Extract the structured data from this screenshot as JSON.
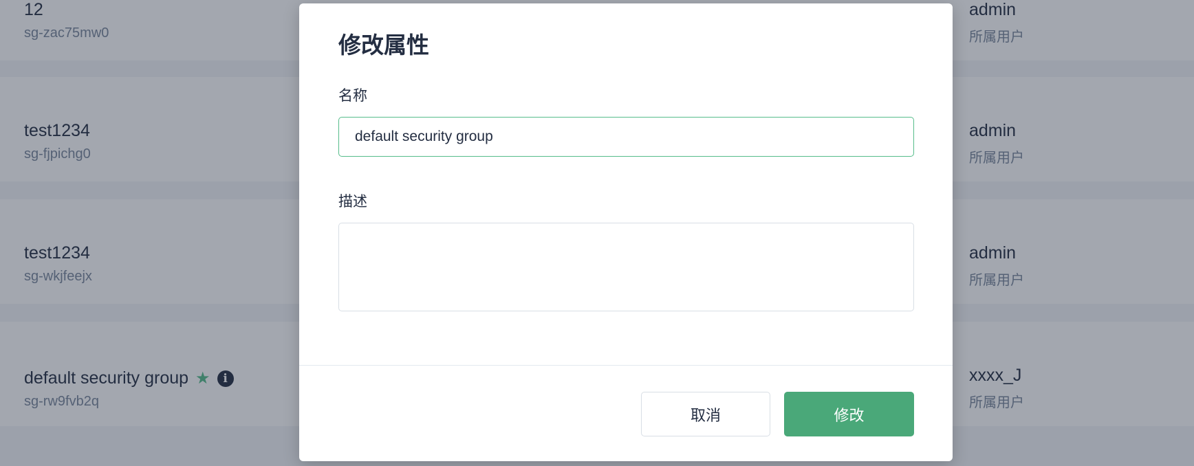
{
  "background_list": [
    {
      "name": "12",
      "id": "sg-zac75mw0",
      "owner": "admin",
      "owner_label": "所属用户"
    },
    {
      "name": "test1234",
      "id": "sg-fjpichg0",
      "owner": "admin",
      "owner_label": "所属用户"
    },
    {
      "name": "test1234",
      "id": "sg-wkjfeejx",
      "owner": "admin",
      "owner_label": "所属用户"
    },
    {
      "name": "default security group",
      "id": "sg-rw9fvb2q",
      "owner": "xxxx_J",
      "owner_label": "所属用户",
      "default_icon": "★",
      "info_icon": "i"
    }
  ],
  "modal": {
    "title": "修改属性",
    "name_label": "名称",
    "name_value": "default security group",
    "desc_label": "描述",
    "desc_value": "",
    "cancel_label": "取消",
    "submit_label": "修改"
  },
  "colors": {
    "accent": "#55bc8a",
    "primary_button": "#4aa879",
    "text": "#242e42",
    "muted_text": "#79879c"
  }
}
